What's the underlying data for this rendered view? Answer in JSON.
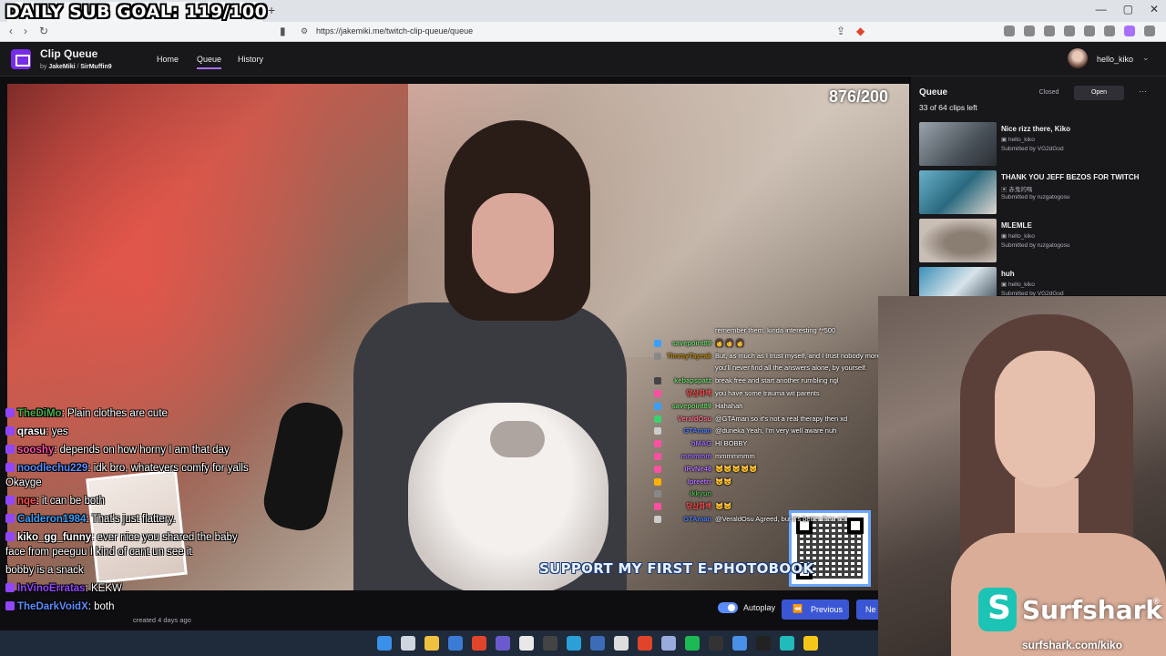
{
  "overlay": {
    "daily_goal": "DAILY SUB GOAL: 119/100"
  },
  "browser": {
    "url": "https://jakemiki.me/twitch-clip-queue/queue"
  },
  "app": {
    "title": "Clip Queue",
    "by_prefix": "by",
    "author1": "JakeMiki",
    "author2": "SirMuffin9",
    "nav": [
      "Home",
      "Queue",
      "History"
    ],
    "username": "hello_kiko"
  },
  "video": {
    "counter": "876/200",
    "support_banner": "SUPPORT MY FIRST E-PHOTOBOOK"
  },
  "stream_chat": [
    {
      "user": "",
      "msg": "remember them, kinda interesting **500",
      "color": "#ffffff",
      "badge": ""
    },
    {
      "user": "savepoint89",
      "msg": "👩 👩 👩",
      "color": "#6bd36b",
      "badge": "#3aa0ff"
    },
    {
      "user": "TimmyTayeak",
      "msg": "But, as much as I trust myself, and I trust nobody more, you'll never find all the answers alone, by yourself.",
      "color": "#b8860b",
      "badge": "#888888"
    },
    {
      "user": "kebapspatz",
      "msg": "break free and start another rumbling ngl",
      "color": "#6bd36b",
      "badge": "#444444"
    },
    {
      "user": "망상화백",
      "msg": "you have some trauma wit parents",
      "color": "#ff5050",
      "badge": "#ff4fa3"
    },
    {
      "user": "savepoint89",
      "msg": "Hahahah",
      "color": "#6bd36b",
      "badge": "#3aa0ff"
    },
    {
      "user": "VeraldOsu",
      "msg": "@GTAman so it's not a real therapy then xd",
      "color": "#ff6a8a",
      "badge": "#3bd16f"
    },
    {
      "user": "GTAman",
      "msg": "@duneka Yeah, I'm very well aware nuh",
      "color": "#4a7bff",
      "badge": "#cccccc"
    },
    {
      "user": "bMAG",
      "msg": "HI BOBBY",
      "color": "#9b6bff",
      "badge": "#ff4fa3"
    },
    {
      "user": "mmmmm",
      "msg": "mmmmmmm",
      "color": "#9b6bff",
      "badge": "#ff4fa3"
    },
    {
      "user": "iRvNe48",
      "msg": "🐱🐱🐱🐱🐱",
      "color": "#b070ff",
      "badge": "#ff4fa3"
    },
    {
      "user": "Ipreetrr",
      "msg": "😺😺",
      "color": "#b070ff",
      "badge": "#ffb000"
    },
    {
      "user": "ikkyun",
      "msg": "",
      "color": "#4cae4c",
      "badge": "#888888"
    },
    {
      "user": "망상화백",
      "msg": "🐱🐱",
      "color": "#ff5050",
      "badge": "#ff4fa3"
    },
    {
      "user": "GTAman",
      "msg": "@VeraldOsu Agreed, but it's better than not",
      "color": "#4a7bff",
      "badge": "#cccccc"
    }
  ],
  "left_chat": [
    {
      "user": "TheDiMo",
      "msg": "Plain clothes are cute",
      "color": "#4cae4c"
    },
    {
      "user": "qrasu",
      "msg": "yes",
      "color": "#ffffff"
    },
    {
      "user": "sooshy",
      "msg": "depends on how horny I am that day",
      "color": "#ff4fa3"
    },
    {
      "user": "noodlechu229",
      "msg": "idk bro, whatevers comfy for yalls Okayge",
      "color": "#5b8cff"
    },
    {
      "user": "nqe",
      "msg": "it can be both",
      "color": "#ff5050"
    },
    {
      "user": "Calderon1984",
      "msg": "That's just flattery.",
      "color": "#3aa0ff"
    },
    {
      "user": "kiko_gg_funny",
      "msg": "ever nice you shared the baby face from peeguu I kind of cant un see it",
      "color": "#ffffff"
    },
    {
      "user": "",
      "msg": "bobby is a snack",
      "color": "#ffffff"
    },
    {
      "user": "InVinoErratas",
      "msg": "KEKW",
      "color": "#9146ff"
    },
    {
      "user": "TheDarkVoidX",
      "msg": "both",
      "color": "#5b8cff"
    }
  ],
  "below_video": {
    "clip_meta": "created 4 days ago",
    "autoplay_label": "Autoplay",
    "prev_label": "Previous",
    "next_label": "Ne"
  },
  "queue": {
    "title": "Queue",
    "count": "33 of 64 clips left",
    "toggle_closed": "Closed",
    "toggle_open": "Open",
    "items": [
      {
        "title": "Nice rizz there, Kiko",
        "channel": "hello_kiko",
        "submitted": "Submitted by VG2dGod"
      },
      {
        "title": "THANK YOU JEFF BEZOS FOR TWITCH",
        "channel": "赤鬼的嗎",
        "submitted": "Submitted by ruzgatogosu"
      },
      {
        "title": "MLEMLE",
        "channel": "hello_kiko",
        "submitted": "Submitted by ruzgatogosu"
      },
      {
        "title": "huh",
        "channel": "hello_kiko",
        "submitted": "Submitted by VG2dGod"
      }
    ]
  },
  "webcam": {
    "sponsor_name": "Surfshark",
    "sponsor_reg": "®",
    "sponsor_url": "surfshark.com/kiko"
  }
}
